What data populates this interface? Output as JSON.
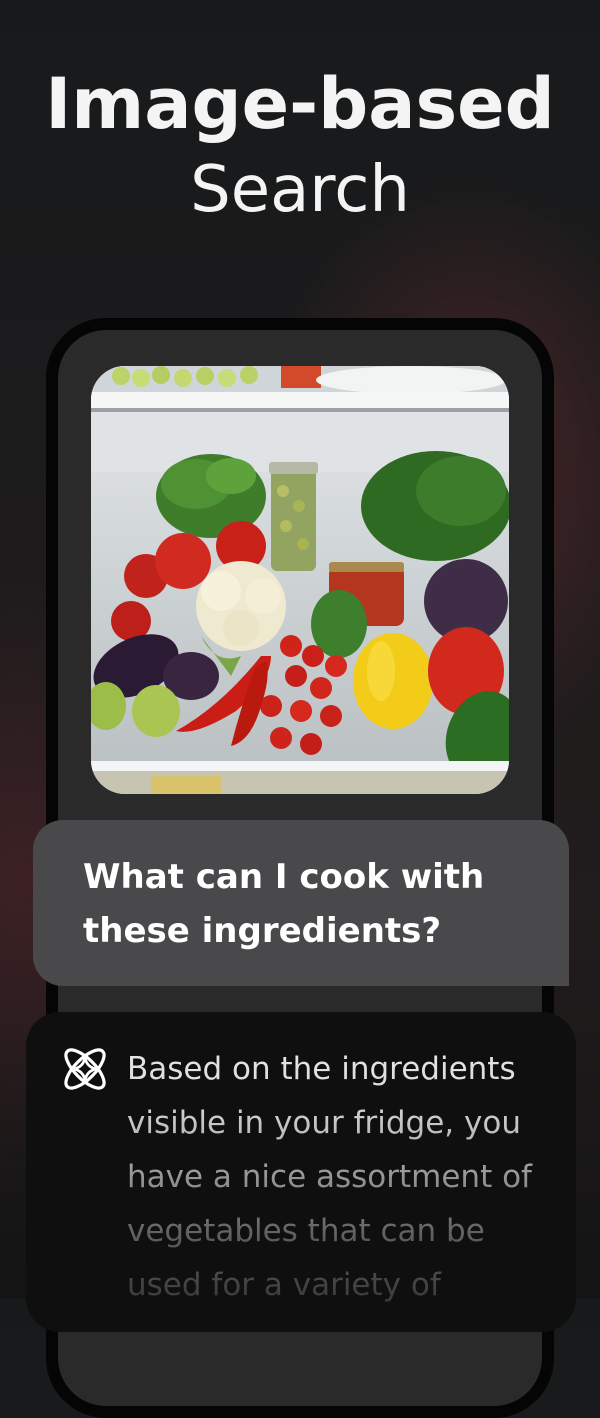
{
  "headline": {
    "line1": "Image-based",
    "line2": "Search"
  },
  "prompt": {
    "text": "What can I cook with these ingredients?"
  },
  "response": {
    "icon": "ai-sparkle-icon",
    "text": "Based on the ingredients visible in your fridge, you have a nice assortment of vegetables that can be used for a variety of"
  },
  "colors": {
    "background": "#171a1b",
    "phone_frame": "#2a2a2b",
    "bubble": "#49494b",
    "answer_card": "#0f0f10",
    "headline": "#f4f4f4"
  }
}
